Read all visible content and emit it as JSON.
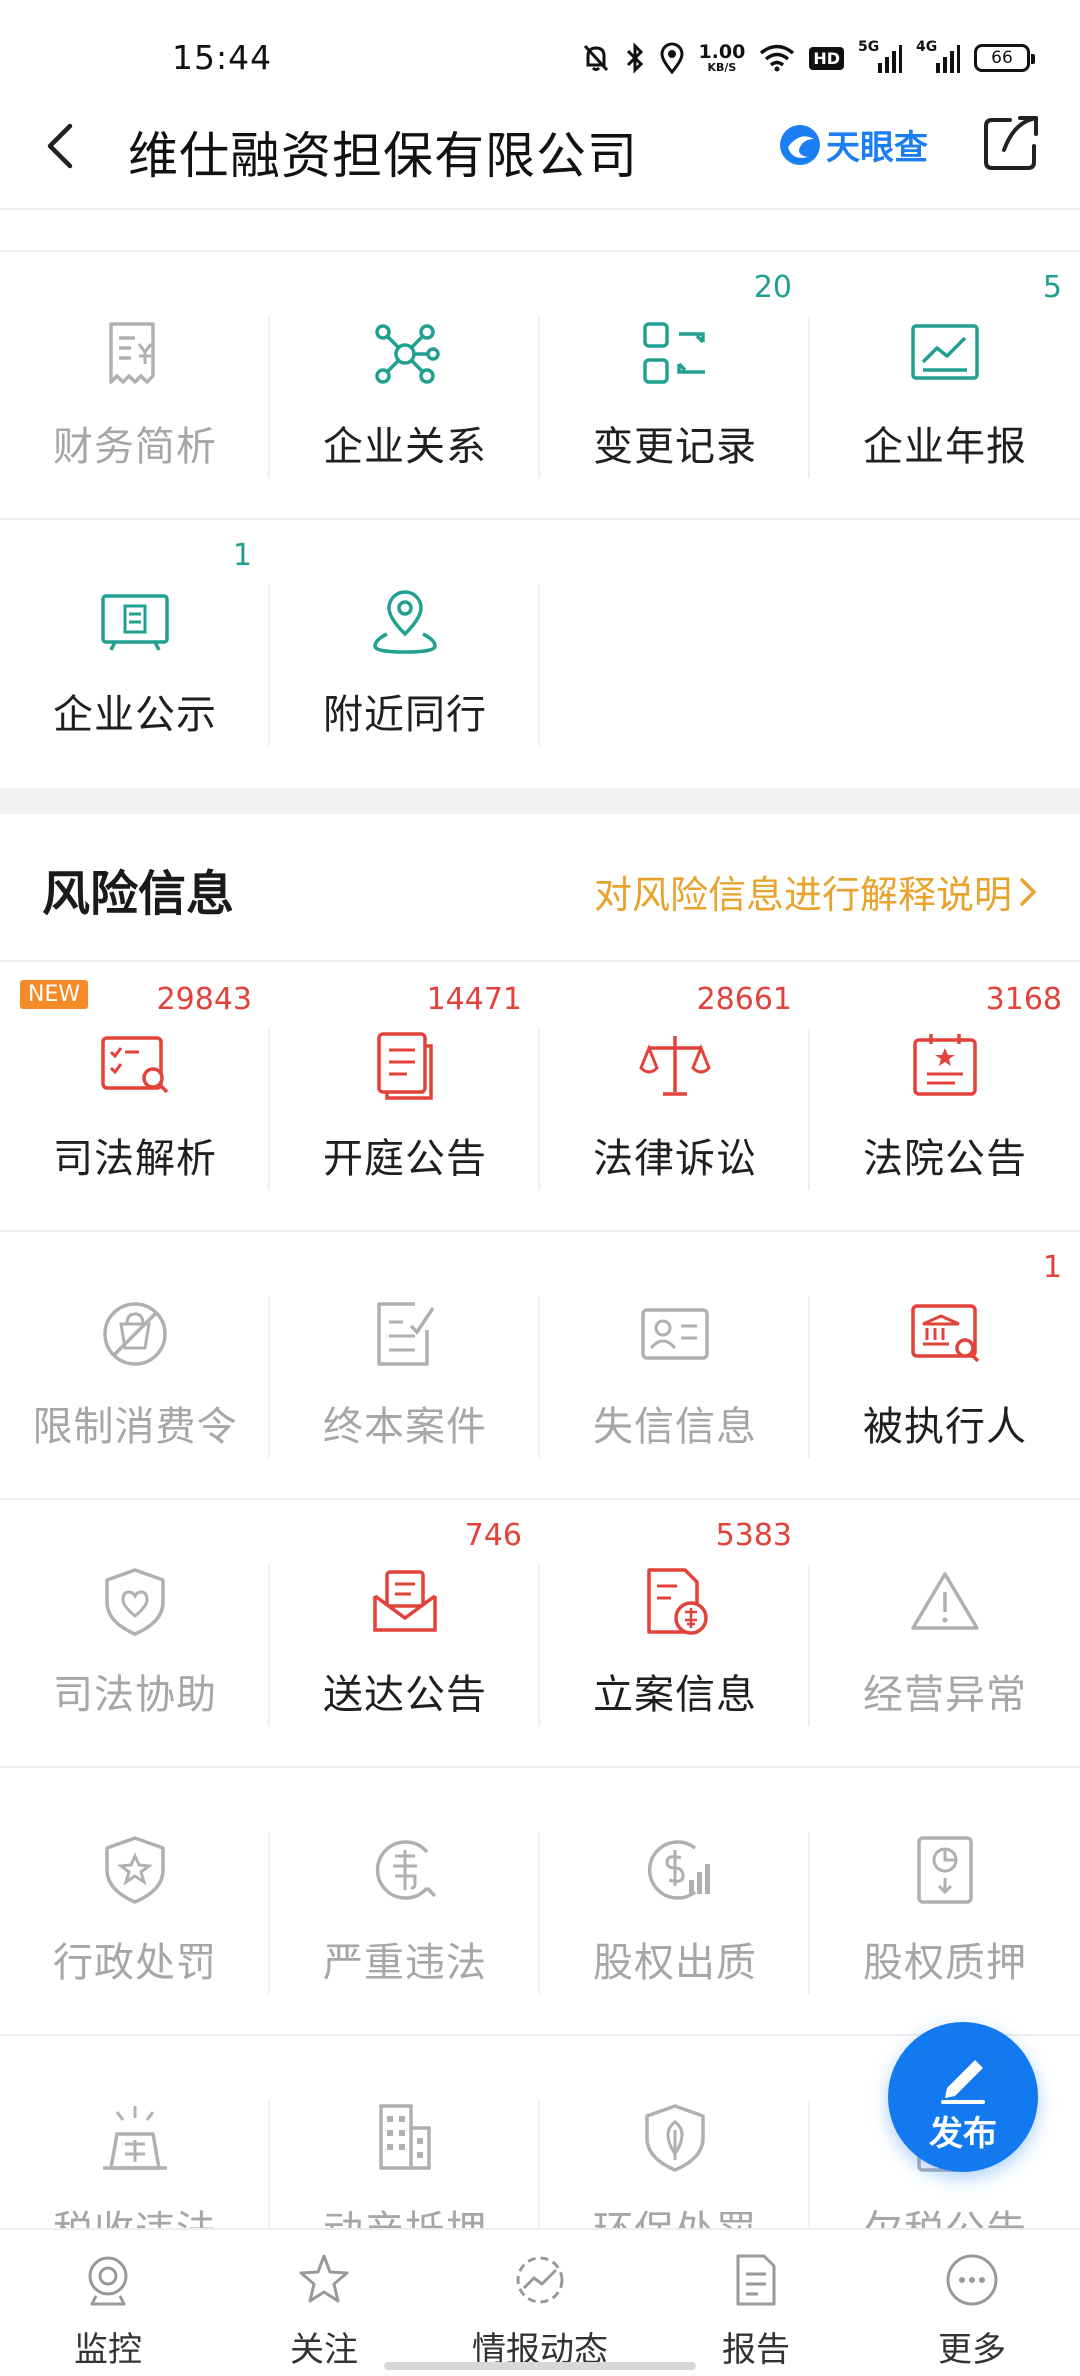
{
  "status_bar": {
    "time": "15:44",
    "speed_value": "1.00",
    "speed_unit": "KB/S",
    "hd_label": "HD",
    "net1_label": "5G",
    "net2_label": "4G",
    "battery": "66"
  },
  "header": {
    "title": "维仕融资担保有限公司",
    "brand": "天眼查"
  },
  "top_grid": {
    "row1": [
      {
        "label": "财务简析",
        "count": "",
        "icon": "finance-report-icon"
      },
      {
        "label": "企业关系",
        "count": "",
        "icon": "network-icon"
      },
      {
        "label": "变更记录",
        "count": "20",
        "icon": "change-record-icon"
      },
      {
        "label": "企业年报",
        "count": "5",
        "icon": "annual-report-icon"
      }
    ],
    "row2": [
      {
        "label": "企业公示",
        "count": "1",
        "icon": "company-publicity-icon"
      },
      {
        "label": "附近同行",
        "count": "",
        "icon": "nearby-peers-icon"
      }
    ]
  },
  "risk": {
    "title": "风险信息",
    "link": "对风险信息进行解释说明",
    "new_badge": "NEW",
    "rows": [
      [
        {
          "label": "司法解析",
          "count": "29843",
          "icon": "judicial-analysis-icon"
        },
        {
          "label": "开庭公告",
          "count": "14471",
          "icon": "court-session-icon"
        },
        {
          "label": "法律诉讼",
          "count": "28661",
          "icon": "scales-icon"
        },
        {
          "label": "法院公告",
          "count": "3168",
          "icon": "court-notice-icon"
        }
      ],
      [
        {
          "label": "限制消费令",
          "count": "",
          "icon": "restrict-consumption-icon"
        },
        {
          "label": "终本案件",
          "count": "",
          "icon": "terminated-case-icon"
        },
        {
          "label": "失信信息",
          "count": "",
          "icon": "dishonesty-icon"
        },
        {
          "label": "被执行人",
          "count": "1",
          "icon": "executed-person-icon"
        }
      ],
      [
        {
          "label": "司法协助",
          "count": "",
          "icon": "judicial-assist-icon"
        },
        {
          "label": "送达公告",
          "count": "746",
          "icon": "service-notice-icon"
        },
        {
          "label": "立案信息",
          "count": "5383",
          "icon": "case-filing-icon"
        },
        {
          "label": "经营异常",
          "count": "",
          "icon": "warning-icon"
        }
      ],
      [
        {
          "label": "行政处罚",
          "count": "",
          "icon": "admin-penalty-icon"
        },
        {
          "label": "严重违法",
          "count": "",
          "icon": "serious-violation-icon"
        },
        {
          "label": "股权出质",
          "count": "",
          "icon": "equity-pledge-icon"
        },
        {
          "label": "股权质押",
          "count": "",
          "icon": "stock-pledge-icon"
        }
      ],
      [
        {
          "label": "税收违法",
          "count": "",
          "icon": "tax-violation-icon"
        },
        {
          "label": "动产抵押",
          "count": "",
          "icon": "chattel-mortgage-icon"
        },
        {
          "label": "环保处罚",
          "count": "",
          "icon": "environment-penalty-icon"
        },
        {
          "label": "欠税公告",
          "count": "",
          "icon": "tax-arrears-icon"
        }
      ]
    ]
  },
  "fab": {
    "label": "发布"
  },
  "bottom_nav": [
    {
      "label": "监控",
      "icon": "monitor-icon"
    },
    {
      "label": "关注",
      "icon": "star-icon"
    },
    {
      "label": "情报动态",
      "icon": "intel-trend-icon"
    },
    {
      "label": "报告",
      "icon": "report-icon"
    },
    {
      "label": "更多",
      "icon": "more-icon"
    }
  ],
  "colors": {
    "green": "#21a090",
    "red": "#e2423a",
    "gray_icon": "#b0b0b0",
    "orange_link": "#e9a22b",
    "brand_blue": "#1b7ef5",
    "fab_blue": "#1379f0"
  }
}
